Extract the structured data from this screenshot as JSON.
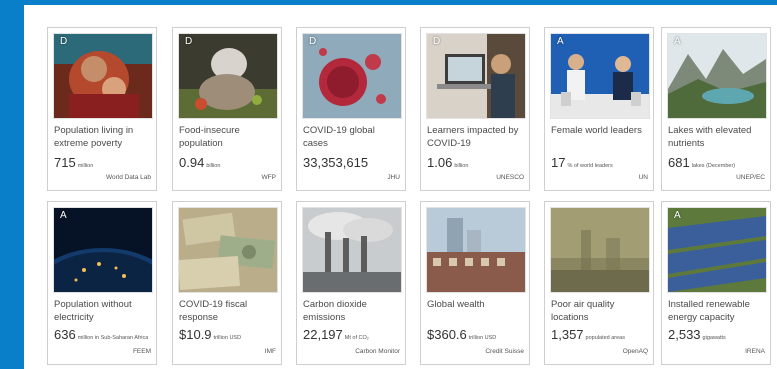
{
  "cards": [
    {
      "letter": "D",
      "title": "Population living in extreme poverty",
      "value": "715",
      "unit": "million",
      "source": "World Data Lab",
      "image": "woman-with-baby"
    },
    {
      "letter": "D",
      "title": "Food-insecure population",
      "value": "0.94",
      "unit": "billion",
      "source": "WFP",
      "image": "child-eating"
    },
    {
      "letter": "D",
      "title": "COVID-19 global cases",
      "value": "33,353,615",
      "unit": "",
      "source": "JHU",
      "image": "virus"
    },
    {
      "letter": "D",
      "title": "Learners impacted by COVID-19",
      "value": "1.06",
      "unit": "billion",
      "source": "UNESCO",
      "image": "laptop-learner"
    },
    {
      "letter": "A",
      "title": "Female world leaders",
      "value": "17",
      "unit": "% of world leaders",
      "source": "UN",
      "image": "leaders-podium"
    },
    {
      "letter": "A",
      "title": "Lakes with elevated nutrients",
      "value": "681",
      "unit": "lakes (December)",
      "source": "UNEP/EC",
      "image": "mountain-lake"
    },
    {
      "letter": "A",
      "title": "Population without electricity",
      "value": "636",
      "unit": "million in Sub-Saharan Africa",
      "source": "FEEM",
      "image": "earth-night"
    },
    {
      "letter": "",
      "title": "COVID-19 fiscal response",
      "value": "$10.9",
      "unit": "trillion USD",
      "source": "IMF",
      "image": "banknotes"
    },
    {
      "letter": "",
      "title": "Carbon dioxide emissions",
      "value": "22,197",
      "unit": "Mt of CO₂",
      "source": "Carbon Monitor",
      "image": "smokestacks"
    },
    {
      "letter": "",
      "title": "Global wealth",
      "value": "$360.6",
      "unit": "trillion USD",
      "source": "Credit Suisse",
      "image": "city-buildings"
    },
    {
      "letter": "",
      "title": "Poor air quality locations",
      "value": "1,357",
      "unit": "populated areas",
      "source": "OpenAQ",
      "image": "smog"
    },
    {
      "letter": "A",
      "title": "Installed renewable energy capacity",
      "value": "2,533",
      "unit": "gigawatts",
      "source": "IRENA",
      "image": "solar-panels"
    }
  ]
}
